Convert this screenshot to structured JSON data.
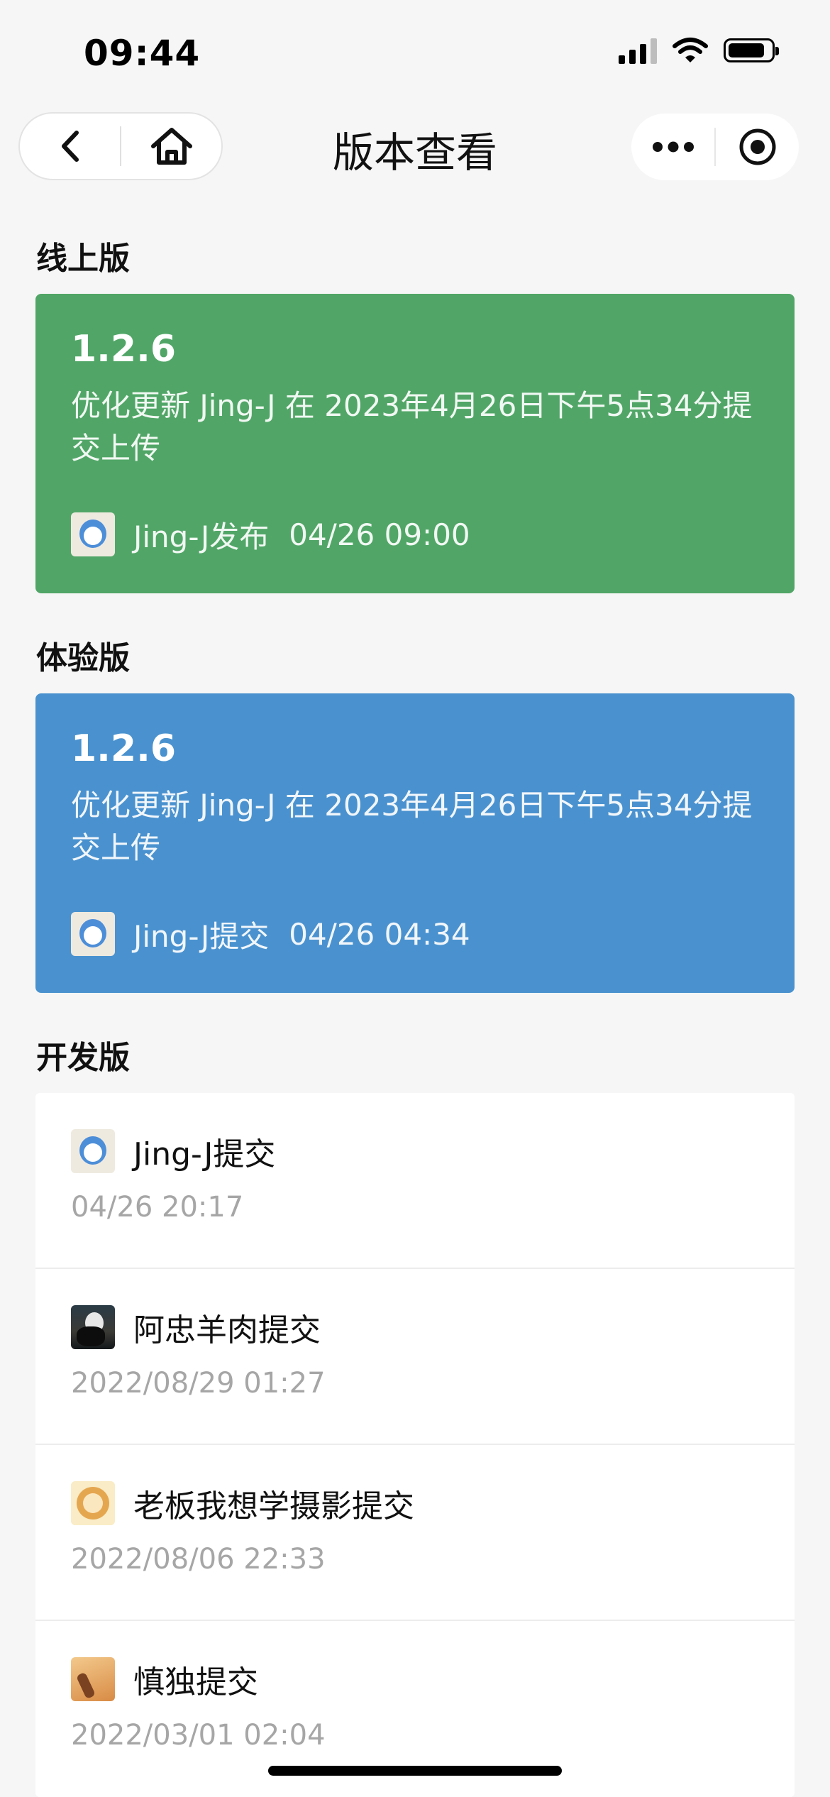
{
  "status_bar": {
    "time": "09:44"
  },
  "nav": {
    "title": "版本查看",
    "icons": [
      "back-arrow-icon",
      "home-icon",
      "more-dots-icon",
      "close-target-icon"
    ]
  },
  "online": {
    "section_title": "线上版",
    "color": "#51a667",
    "version": "1.2.6",
    "description": "优化更新 Jing-J 在 2023年4月26日下午5点34分提交上传",
    "author": "Jing-J发布",
    "time": "04/26 09:00"
  },
  "trial": {
    "section_title": "体验版",
    "color": "#4a92cf",
    "version": "1.2.6",
    "description": "优化更新 Jing-J 在 2023年4月26日下午5点34分提交上传",
    "author": "Jing-J提交",
    "time": "04/26 04:34"
  },
  "dev": {
    "section_title": "开发版",
    "items": [
      {
        "author": "Jing-J提交",
        "date": "04/26 20:17"
      },
      {
        "author": "阿忠羊肉提交",
        "date": "2022/08/29 01:27"
      },
      {
        "author": "老板我想学摄影提交",
        "date": "2022/08/06 22:33"
      },
      {
        "author": "慎独提交",
        "date": "2022/03/01 02:04"
      }
    ]
  }
}
